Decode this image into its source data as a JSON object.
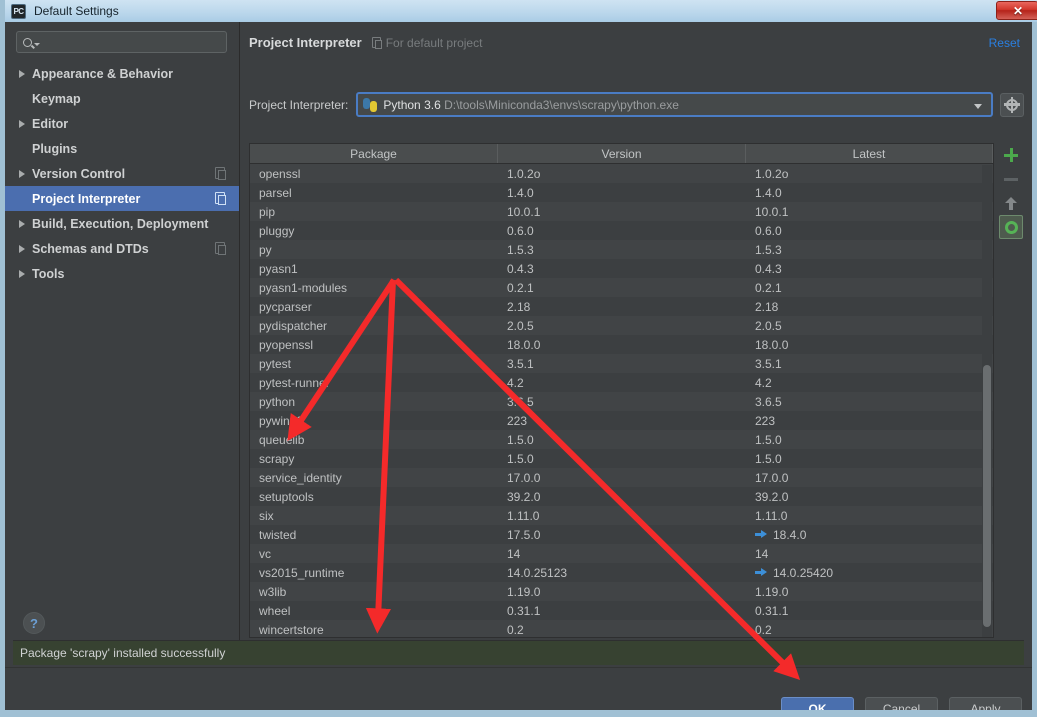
{
  "window": {
    "title": "Default Settings",
    "app_icon": "PC",
    "close_label": "✕"
  },
  "sidebar": {
    "search": {
      "value": "",
      "placeholder": ""
    },
    "items": [
      {
        "label": "Appearance & Behavior",
        "expandable": true,
        "selected": false,
        "copy_icon": false
      },
      {
        "label": "Keymap",
        "expandable": false,
        "selected": false,
        "copy_icon": false
      },
      {
        "label": "Editor",
        "expandable": true,
        "selected": false,
        "copy_icon": false
      },
      {
        "label": "Plugins",
        "expandable": false,
        "selected": false,
        "copy_icon": false
      },
      {
        "label": "Version Control",
        "expandable": true,
        "selected": false,
        "copy_icon": true
      },
      {
        "label": "Project Interpreter",
        "expandable": false,
        "selected": true,
        "copy_icon": true
      },
      {
        "label": "Build, Execution, Deployment",
        "expandable": true,
        "selected": false,
        "copy_icon": false
      },
      {
        "label": "Schemas and DTDs",
        "expandable": true,
        "selected": false,
        "copy_icon": true
      },
      {
        "label": "Tools",
        "expandable": true,
        "selected": false,
        "copy_icon": false
      }
    ],
    "help_label": "?"
  },
  "main": {
    "page_title": "Project Interpreter",
    "scope_label": "For default project",
    "reset_label": "Reset",
    "interpreter": {
      "field_label": "Project Interpreter:",
      "name": "Python 3.6",
      "path": "D:\\tools\\Miniconda3\\envs\\scrapy\\python.exe"
    },
    "toolbar": {
      "add_label": "Install",
      "remove_label": "Uninstall",
      "upgrade_label": "Upgrade",
      "show_early_label": "Show early releases"
    },
    "table": {
      "columns": [
        "Package",
        "Version",
        "Latest"
      ],
      "rows": [
        {
          "package": "openssl",
          "version": "1.0.2o",
          "latest": "1.0.2o",
          "upgradable": false
        },
        {
          "package": "parsel",
          "version": "1.4.0",
          "latest": "1.4.0",
          "upgradable": false
        },
        {
          "package": "pip",
          "version": "10.0.1",
          "latest": "10.0.1",
          "upgradable": false
        },
        {
          "package": "pluggy",
          "version": "0.6.0",
          "latest": "0.6.0",
          "upgradable": false
        },
        {
          "package": "py",
          "version": "1.5.3",
          "latest": "1.5.3",
          "upgradable": false
        },
        {
          "package": "pyasn1",
          "version": "0.4.3",
          "latest": "0.4.3",
          "upgradable": false
        },
        {
          "package": "pyasn1-modules",
          "version": "0.2.1",
          "latest": "0.2.1",
          "upgradable": false
        },
        {
          "package": "pycparser",
          "version": "2.18",
          "latest": "2.18",
          "upgradable": false
        },
        {
          "package": "pydispatcher",
          "version": "2.0.5",
          "latest": "2.0.5",
          "upgradable": false
        },
        {
          "package": "pyopenssl",
          "version": "18.0.0",
          "latest": "18.0.0",
          "upgradable": false
        },
        {
          "package": "pytest",
          "version": "3.5.1",
          "latest": "3.5.1",
          "upgradable": false
        },
        {
          "package": "pytest-runner",
          "version": "4.2",
          "latest": "4.2",
          "upgradable": false
        },
        {
          "package": "python",
          "version": "3.6.5",
          "latest": "3.6.5",
          "upgradable": false
        },
        {
          "package": "pywin32",
          "version": "223",
          "latest": "223",
          "upgradable": false
        },
        {
          "package": "queuelib",
          "version": "1.5.0",
          "latest": "1.5.0",
          "upgradable": false
        },
        {
          "package": "scrapy",
          "version": "1.5.0",
          "latest": "1.5.0",
          "upgradable": false
        },
        {
          "package": "service_identity",
          "version": "17.0.0",
          "latest": "17.0.0",
          "upgradable": false
        },
        {
          "package": "setuptools",
          "version": "39.2.0",
          "latest": "39.2.0",
          "upgradable": false
        },
        {
          "package": "six",
          "version": "1.11.0",
          "latest": "1.11.0",
          "upgradable": false
        },
        {
          "package": "twisted",
          "version": "17.5.0",
          "latest": "18.4.0",
          "upgradable": true
        },
        {
          "package": "vc",
          "version": "14",
          "latest": "14",
          "upgradable": false
        },
        {
          "package": "vs2015_runtime",
          "version": "14.0.25123",
          "latest": "14.0.25420",
          "upgradable": true
        },
        {
          "package": "w3lib",
          "version": "1.19.0",
          "latest": "1.19.0",
          "upgradable": false
        },
        {
          "package": "wheel",
          "version": "0.31.1",
          "latest": "0.31.1",
          "upgradable": false
        },
        {
          "package": "wincertstore",
          "version": "0.2",
          "latest": "0.2",
          "upgradable": false
        }
      ]
    },
    "status_message": "Package 'scrapy' installed successfully"
  },
  "footer": {
    "ok_label": "OK",
    "cancel_label": "Cancel",
    "apply_label": "Apply"
  },
  "colors": {
    "accent_blue": "#4a6fae",
    "link_blue": "#2a7fe0",
    "upgrade_blue": "#3c8fd8",
    "success_green_bg": "#374231",
    "annotation_red": "#f42a2a",
    "selection_blue": "#4b6eaf"
  }
}
